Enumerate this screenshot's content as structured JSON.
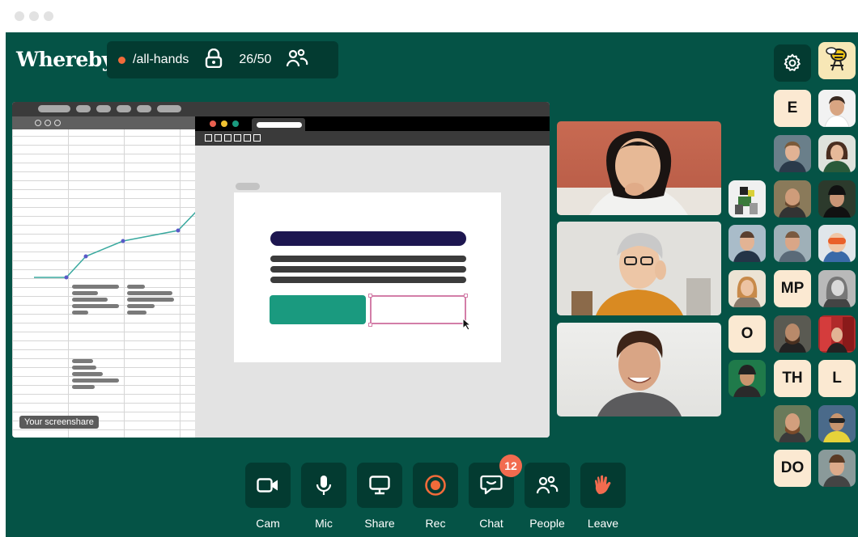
{
  "app": {
    "logo": "Whereby",
    "room_name": "/all-hands",
    "participant_count": "26/50",
    "accent_color": "#055346",
    "button_color": "#033b31"
  },
  "screenshare": {
    "label": "Your screenshare"
  },
  "tiles": [
    {
      "initials": "E"
    },
    {
      "initials": "MP"
    },
    {
      "initials": "O"
    },
    {
      "initials": "TH"
    },
    {
      "initials": "L"
    },
    {
      "initials": "DO"
    }
  ],
  "controls": {
    "cam": "Cam",
    "mic": "Mic",
    "share": "Share",
    "rec": "Rec",
    "chat": "Chat",
    "chat_unread": "12",
    "people": "People",
    "leave": "Leave"
  },
  "icons": [
    "lock-icon",
    "people-icon",
    "gear-icon",
    "camera-icon",
    "microphone-icon",
    "monitor-icon",
    "record-icon",
    "chat-icon",
    "people-icon",
    "wave-hand-icon"
  ]
}
